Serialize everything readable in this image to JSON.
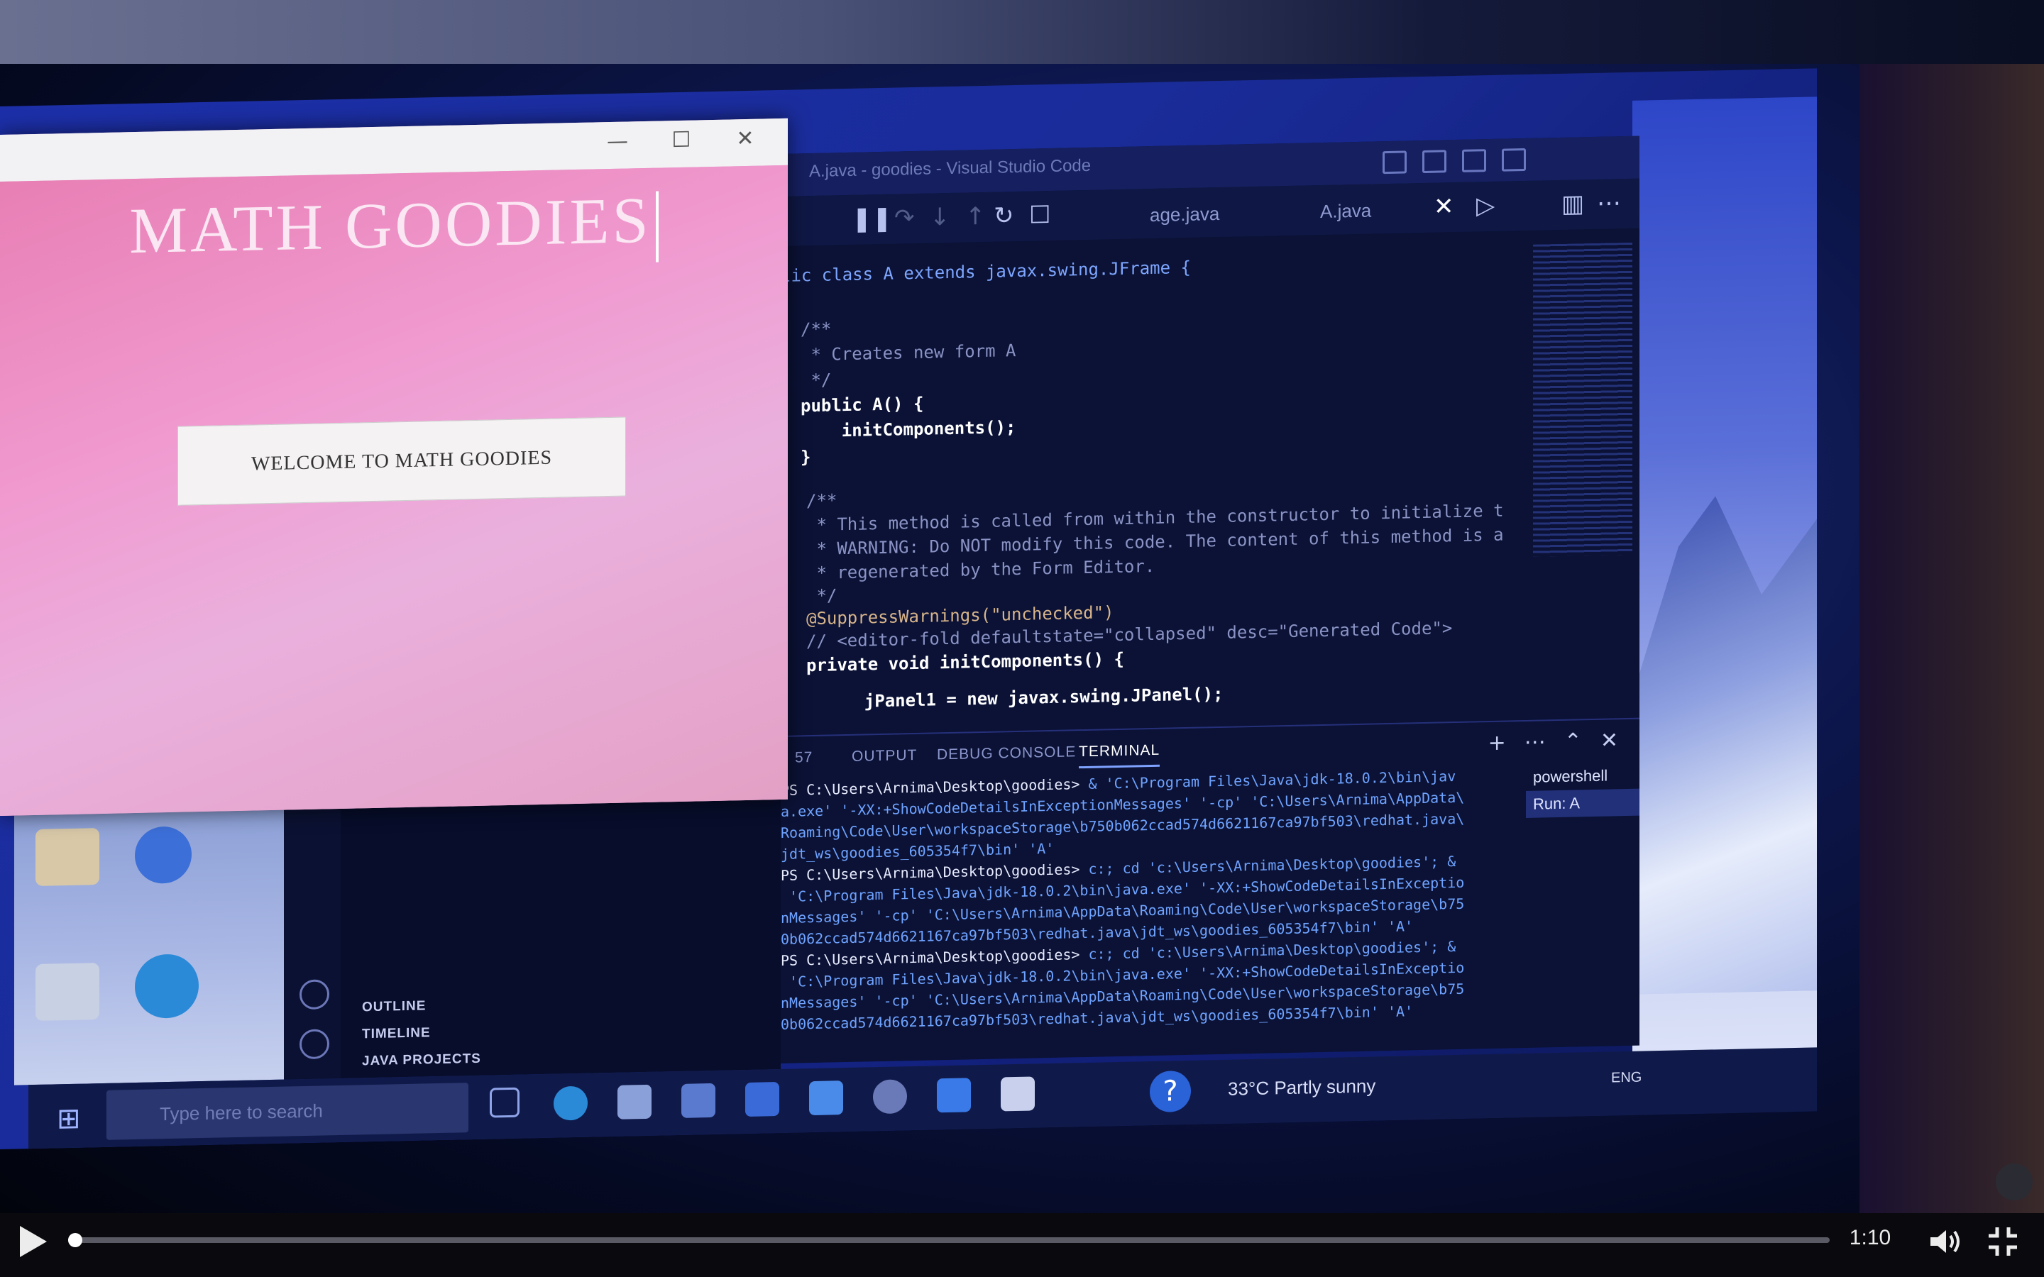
{
  "app_window": {
    "title": "MATH GOODIES",
    "button_label": "WELCOME TO MATH GOODIES"
  },
  "vscode": {
    "window_title": "A.java - goodies - Visual Studio Code",
    "tabs": [
      "age.java",
      "A.java"
    ],
    "code_lines": [
      "lic class A extends javax.swing.JFrame {",
      "/**",
      " * Creates new form A",
      " */",
      "public A() {",
      "    initComponents();",
      "}",
      "/**",
      " * This method is called from within the constructor to initialize t",
      " * WARNING: Do NOT modify this code. The content of this method is a",
      " * regenerated by the Form Editor.",
      " */",
      "@SuppressWarnings(\"unchecked\")",
      "// <editor-fold defaultstate=\"collapsed\" desc=\"Generated Code\">",
      "private void initComponents() {",
      "    jPanel1 = new javax.swing.JPanel();"
    ],
    "panel_tabs": {
      "badge": "57",
      "output": "OUTPUT",
      "debug_console": "DEBUG CONSOLE",
      "terminal": "TERMINAL"
    },
    "terminal_lines": [
      {
        "prompt": "PS C:\\Users\\Arnima\\Desktop\\goodies>",
        "cmd": " & 'C:\\Program Files\\Java\\jdk-18.0.2\\bin\\jav"
      },
      {
        "prompt": "",
        "cmd": "a.exe' '-XX:+ShowCodeDetailsInExceptionMessages' '-cp' 'C:\\Users\\Arnima\\AppData\\"
      },
      {
        "prompt": "",
        "cmd": "Roaming\\Code\\User\\workspaceStorage\\b750b062ccad574d6621167ca97bf503\\redhat.java\\"
      },
      {
        "prompt": "",
        "cmd": "jdt_ws\\goodies_605354f7\\bin' 'A'"
      },
      {
        "prompt": "PS C:\\Users\\Arnima\\Desktop\\goodies>",
        "cmd": " c:; cd 'c:\\Users\\Arnima\\Desktop\\goodies'; &"
      },
      {
        "prompt": "",
        "cmd": " 'C:\\Program Files\\Java\\jdk-18.0.2\\bin\\java.exe' '-XX:+ShowCodeDetailsInExceptio"
      },
      {
        "prompt": "",
        "cmd": "nMessages' '-cp' 'C:\\Users\\Arnima\\AppData\\Roaming\\Code\\User\\workspaceStorage\\b75"
      },
      {
        "prompt": "",
        "cmd": "0b062ccad574d6621167ca97bf503\\redhat.java\\jdt_ws\\goodies_605354f7\\bin' 'A'"
      },
      {
        "prompt": "PS C:\\Users\\Arnima\\Desktop\\goodies>",
        "cmd": " c:; cd 'c:\\Users\\Arnima\\Desktop\\goodies'; &"
      },
      {
        "prompt": "",
        "cmd": " 'C:\\Program Files\\Java\\jdk-18.0.2\\bin\\java.exe' '-XX:+ShowCodeDetailsInExceptio"
      },
      {
        "prompt": "",
        "cmd": "nMessages' '-cp' 'C:\\Users\\Arnima\\AppData\\Roaming\\Code\\User\\workspaceStorage\\b75"
      },
      {
        "prompt": "",
        "cmd": "0b062ccad574d6621167ca97bf503\\redhat.java\\jdt_ws\\goodies_605354f7\\bin' 'A'"
      }
    ],
    "terminal_list": [
      "powershell",
      "Run: A"
    ],
    "explorer_sections": [
      "OUTLINE",
      "TIMELINE",
      "JAVA PROJECTS"
    ]
  },
  "taskbar": {
    "search_placeholder": "Type here to search",
    "weather": "33°C  Partly sunny",
    "lang": "ENG"
  },
  "player": {
    "time": "1:10",
    "progress": 0.0
  },
  "colors": {
    "app_pink": "#eaa0d0",
    "editor_bg": "#0b1236",
    "accent": "#7fa2ff"
  }
}
